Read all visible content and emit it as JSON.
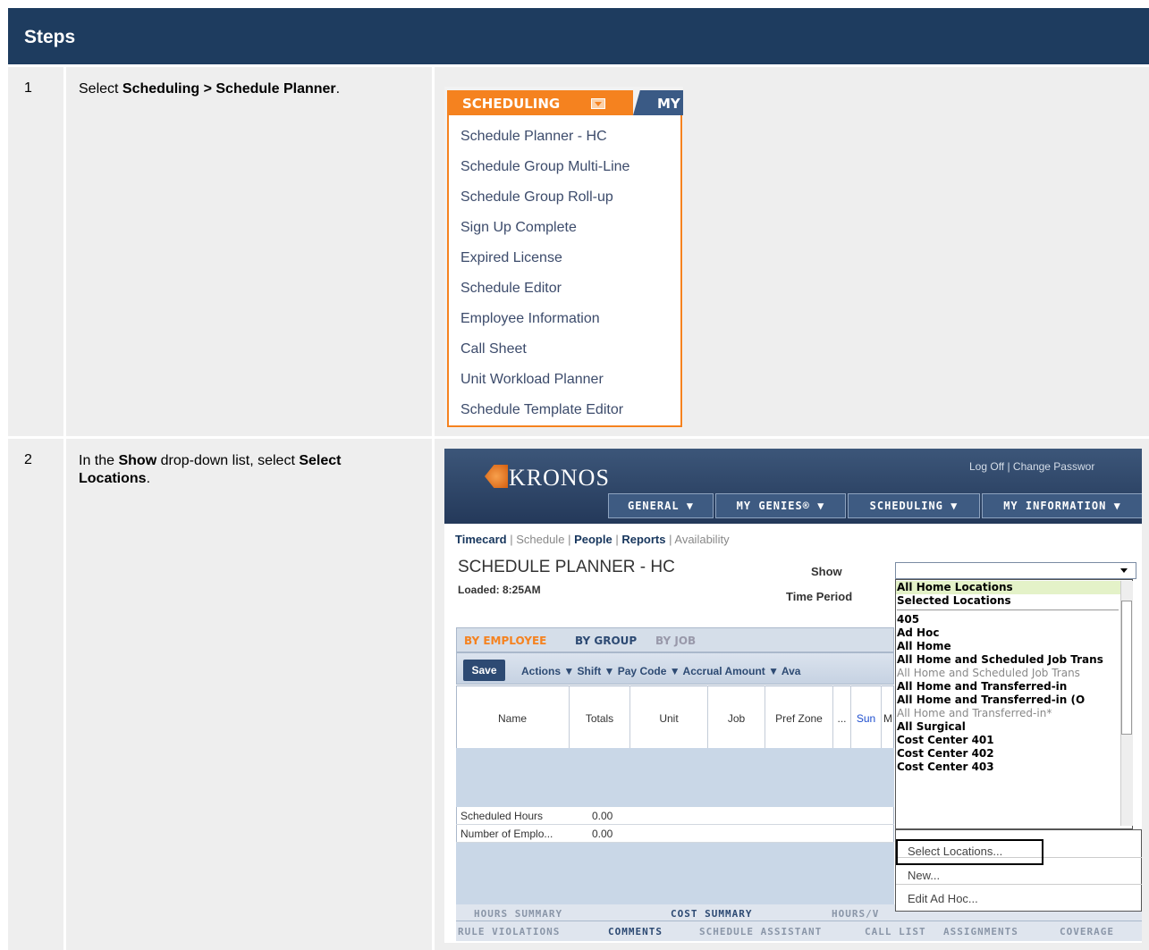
{
  "header": {
    "title": "Steps"
  },
  "steps": [
    {
      "number": "1",
      "text_pre": "Select ",
      "text_bold1": "Scheduling > Schedule Planner",
      "text_post": ".",
      "menu": {
        "tab_label": "SCHEDULING",
        "next_tab_label": "MY",
        "items": [
          "Schedule Planner - HC",
          "Schedule Group Multi-Line",
          "Schedule Group Roll-up",
          "Sign Up Complete",
          "Expired License",
          "Schedule Editor",
          "Employee Information",
          "Call Sheet",
          "Unit Workload Planner",
          "Schedule Template Editor"
        ]
      }
    },
    {
      "number": "2",
      "text_pre": "In the ",
      "text_bold1": "Show",
      "text_mid": " drop-down list, select ",
      "text_bold2": "Select Locations",
      "text_post": ".",
      "app": {
        "logo": "KRONOS",
        "logoff_text": "Log Off | Change Passwor",
        "top_tabs": [
          "GENERAL ▼",
          "MY GENIES® ▼",
          "SCHEDULING ▼",
          "MY INFORMATION ▼"
        ],
        "subnav": [
          "Timecard",
          "Schedule",
          "People",
          "Reports",
          "Availability"
        ],
        "page_title": "SCHEDULE PLANNER - HC",
        "loaded": "Loaded: 8:25AM",
        "show_label": "Show",
        "time_period_label": "Time Period",
        "view_tabs": [
          "BY EMPLOYEE",
          "BY GROUP",
          "BY JOB"
        ],
        "save_label": "Save",
        "toolbar_menus": "Actions ▼  Shift ▼  Pay Code ▼  Accrual Amount ▼  Ava",
        "columns": [
          "Name",
          "Totals",
          "Unit",
          "Job",
          "Pref Zone",
          "...",
          "Sun",
          "M"
        ],
        "rows": [
          {
            "name": "Scheduled Hours",
            "total": "0.00"
          },
          {
            "name": "Number of Emplo...",
            "total": "0.00"
          }
        ],
        "bottom_tabs_row1": [
          "HOURS SUMMARY",
          "COST SUMMARY",
          "HOURS/V"
        ],
        "bottom_tabs_row2": [
          "RULE VIOLATIONS",
          "COMMENTS",
          "SCHEDULE ASSISTANT",
          "CALL LIST",
          "ASSIGNMENTS",
          "COVERAGE"
        ],
        "dropdown_items": [
          "All Home Locations",
          "Selected Locations",
          "405",
          "Ad Hoc",
          "All Home",
          "All Home and Scheduled Job Trans",
          "All Home and Scheduled Job Trans",
          "All Home and Transferred-in",
          "All Home and Transferred-in (O",
          "All Home and Transferred-in*",
          "All Surgical",
          "Cost Center 401",
          "Cost Center 402",
          "Cost Center 403"
        ],
        "dropdown_actions": [
          "Select Locations...",
          "New...",
          "Edit Ad Hoc..."
        ]
      }
    }
  ],
  "colors": {
    "header_bg": "#1e3c5f",
    "kronos_orange": "#f5821f",
    "kronos_navy": "#2d4a73"
  }
}
